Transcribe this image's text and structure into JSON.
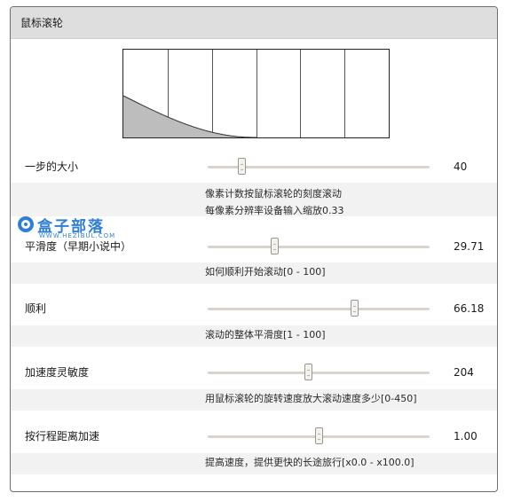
{
  "panel": {
    "title": "鼠标滚轮"
  },
  "preview": {
    "columns": 6,
    "curve_fill": "#bdbdbd",
    "curve_stroke": "#333333"
  },
  "settings": [
    {
      "label": "一步的大小",
      "value": "40",
      "fraction": 0.15,
      "desc": [
        "像素计数按鼠标滚轮的刻度滚动",
        "每像素分辨率设备输入缩放0.33"
      ]
    },
    {
      "label": "平滑度（早期小说中）",
      "value": "29.71",
      "fraction": 0.3,
      "desc": [
        "如何顺利开始滚动[0 - 100]"
      ]
    },
    {
      "label": "顺利",
      "value": "66.18",
      "fraction": 0.66,
      "desc": [
        "滚动的整体平滑度[1 - 100]"
      ]
    },
    {
      "label": "加速度灵敏度",
      "value": "204",
      "fraction": 0.45,
      "desc": [
        "用鼠标滚轮的旋转速度放大滚动速度多少[0-450]"
      ]
    },
    {
      "label": "按行程距离加速",
      "value": "1.00",
      "fraction": 0.5,
      "desc": [
        "提高速度，提供更快的长途旅行[x0.0 - x100.0]"
      ]
    }
  ],
  "watermark": {
    "text": "盒子部落",
    "sub": "WWW.HEZIBUL.COM",
    "color": "#2f7fd6"
  }
}
